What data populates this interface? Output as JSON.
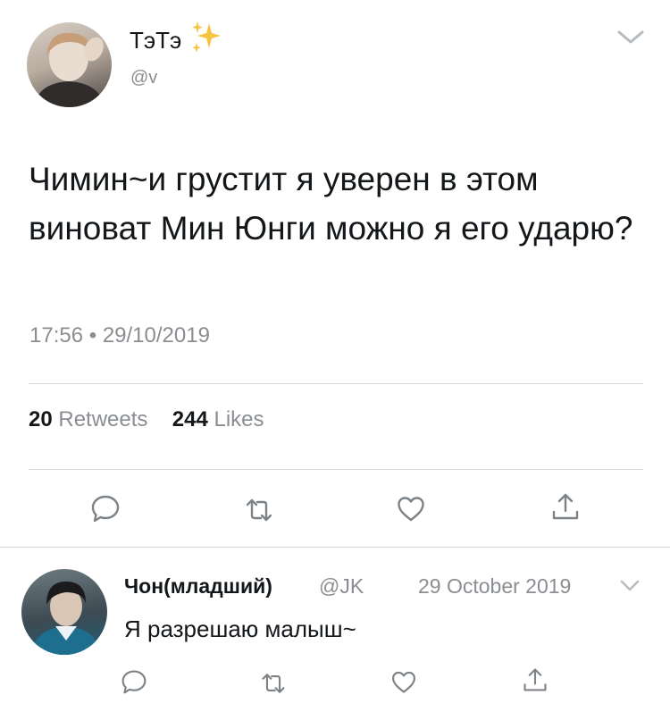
{
  "tweet": {
    "author_name": "ТэТэ",
    "author_handle": "@v",
    "text": "Чимин~и грустит я уверен в этом виноват Мин Юнги можно я его ударю?",
    "time": "17:56",
    "date": "29/10/2019",
    "stats": {
      "retweets_count": "20",
      "retweets_label": "Retweets",
      "likes_count": "244",
      "likes_label": "Likes"
    }
  },
  "reply": {
    "author_name": "Чон(младший)",
    "author_handle": "@JK",
    "date": "29 October 2019",
    "text": "Я разрешаю малыш~"
  },
  "icons": {
    "sparkle": "sparkles-icon",
    "chevron": "chevron-down-icon",
    "reply": "reply-icon",
    "retweet": "retweet-icon",
    "like": "heart-icon",
    "share": "share-icon"
  },
  "colors": {
    "text": "#14171a",
    "secondary": "#8a8d91",
    "divider": "#d6dadd",
    "sparkle": "#f5c542"
  }
}
